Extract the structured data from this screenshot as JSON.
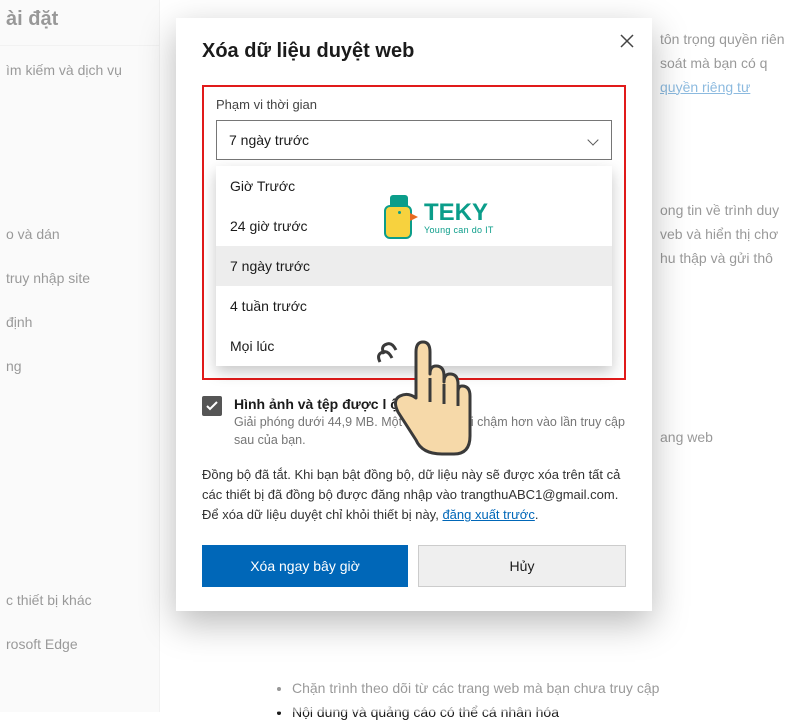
{
  "sidebar": {
    "title": "ài đặt",
    "items": [
      {
        "label": "ìm kiếm và dịch vụ"
      },
      {
        "label": "o và dán"
      },
      {
        "label": " truy nhập site"
      },
      {
        "label": "định"
      },
      {
        "label": "ng"
      },
      {
        "label": "c thiết bị khác"
      },
      {
        "label": "rosoft Edge"
      }
    ]
  },
  "bg": {
    "right_top_1": "tôn trọng quyền riên",
    "right_top_2": "soát mà bạn có q",
    "right_top_link": "quyền riêng tư",
    "right_mid_1": "ong tin về trình duy",
    "right_mid_2": "veb và hiển thị chơ",
    "right_mid_3": "hu thập và gửi thô",
    "right_small": "ang web",
    "bullet1": "Chặn trình theo dõi từ các trang web mà bạn chưa truy cập",
    "bullet2": "Nội dung và quảng cáo có thể cá nhân hóa"
  },
  "modal": {
    "title": "Xóa dữ liệu duyệt web",
    "range_label": "Phạm vi thời gian",
    "selected": "7 ngày trước",
    "options": [
      "Giờ Trước",
      "24 giờ trước",
      "7 ngày trước",
      "4 tuần trước",
      "Mọi lúc"
    ],
    "check_label": "Hình ảnh và tệp được l              ộ đệm ẩn",
    "check_desc": "Giải phóng dưới 44,9 MB. Một              eb có thể tải chậm hơn vào lần truy cập sau của bạn.",
    "sync_note_1": "Đồng bộ đã tắt. Khi bạn bật đồng bộ, dữ liệu này sẽ được xóa trên tất cả các thiết bị đã đồng bộ được đăng nhập vào trangthuABC1@gmail.com. Để xóa dữ liệu duyệt chỉ khỏi thiết bị này, ",
    "sync_link": "đăng xuất trước",
    "btn_primary": "Xóa ngay bây giờ",
    "btn_secondary": "Hủy"
  },
  "logo": {
    "text": "TEKY",
    "sub": "Young can do IT"
  }
}
